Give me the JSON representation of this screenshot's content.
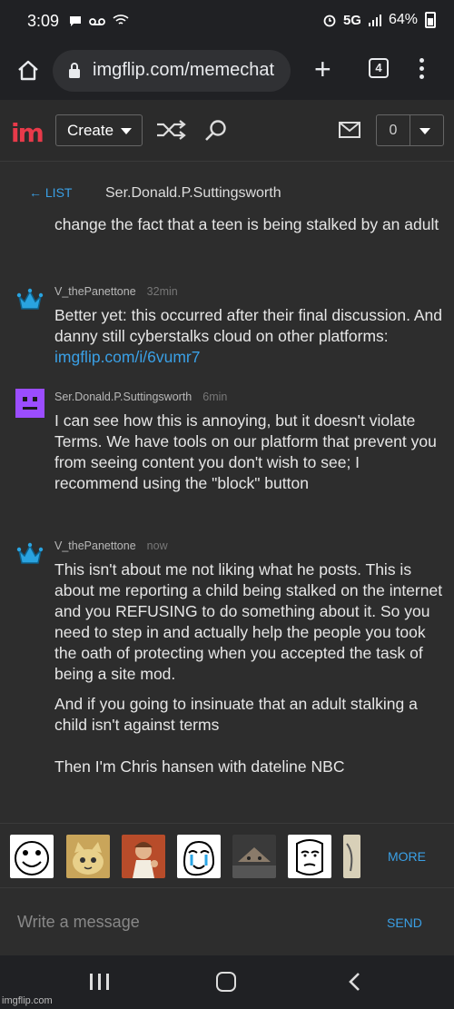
{
  "status_bar": {
    "time": "3:09",
    "left_icons": [
      "message-icon",
      "voicemail-icon",
      "wifi-icon"
    ],
    "right_text": "5G",
    "battery": "64%"
  },
  "browser": {
    "url": "imgflip.com/memechat",
    "tab_count": "4"
  },
  "site": {
    "logo": "im",
    "create_label": "Create",
    "notification_count": "0"
  },
  "conversation": {
    "back_label": "← LIST",
    "title": "Ser.Donald.P.Suttingsworth",
    "cutoff_text": "change the fact that a teen is being stalked by an adult",
    "messages": [
      {
        "author": "V_thePanettone",
        "time": "32min",
        "text": "Better yet: this occurred after their final discussion. And danny still cyberstalks cloud on other platforms: ",
        "link": "imgflip.com/i/6vumr7"
      },
      {
        "author": "Ser.Donald.P.Suttingsworth",
        "time": "6min",
        "text": "I can see how this is annoying, but it doesn't violate Terms. We have tools on our platform that prevent you from seeing content you don't wish to see; I recommend using the \"block\" button"
      },
      {
        "author": "V_thePanettone",
        "time": "now",
        "paragraphs": [
          "This isn't about me not liking what he posts. This is about me reporting a child being stalked on the internet and you REFUSING to do something about it. So you need to step in and actually help the people you took the oath of protecting when you accepted the task of being a site mod.",
          "And if you going to insinuate that an adult stalking a child isn't against terms",
          "Then I'm Chris hansen with dateline NBC"
        ]
      }
    ]
  },
  "meme_picker": {
    "thumbs": [
      "rage-face-smile",
      "crying-cat",
      "buddy-christ",
      "tearful-rage-face",
      "grumpy-cat",
      "okay-guy",
      "partial-meme"
    ],
    "more_label": "MORE"
  },
  "composer": {
    "placeholder": "Write a message",
    "send_label": "SEND"
  },
  "watermark": "imgflip.com",
  "colors": {
    "accent": "#3aa0e6",
    "logo": "#e83a4a",
    "background": "#2d2d2d",
    "crown": "#29a3e0",
    "avatar_purple": "#9b4dff"
  }
}
